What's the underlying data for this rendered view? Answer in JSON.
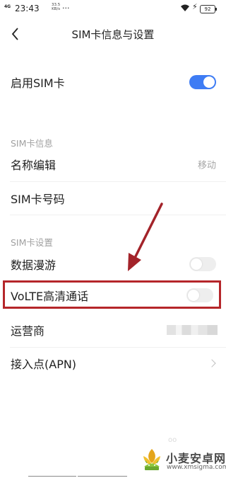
{
  "status_bar": {
    "signal": "4G",
    "time": "23:43",
    "speed_value": "33.5",
    "speed_unit": "KB/s",
    "dots": "···",
    "battery": "92"
  },
  "header": {
    "title": "SIM卡信息与设置"
  },
  "enable_sim": {
    "label": "启用SIM卡",
    "on": true
  },
  "sim_info": {
    "section_title": "SIM卡信息",
    "name_edit_label": "名称编辑",
    "name_edit_value": "移动",
    "sim_number_label": "SIM卡号码"
  },
  "sim_settings": {
    "section_title": "SIM卡设置",
    "data_roaming_label": "数据漫游",
    "data_roaming_on": false,
    "volte_label": "VoLTE高清通话",
    "volte_on": false,
    "carrier_label": "运营商",
    "apn_label": "接入点(APN)"
  },
  "colors": {
    "accent": "#3e7cf4",
    "highlight": "#b5262a",
    "arrow": "#a3232a"
  },
  "watermark": {
    "brand": "小麦安卓网",
    "url": "www.xmsigma.com",
    "faint": "oo"
  }
}
